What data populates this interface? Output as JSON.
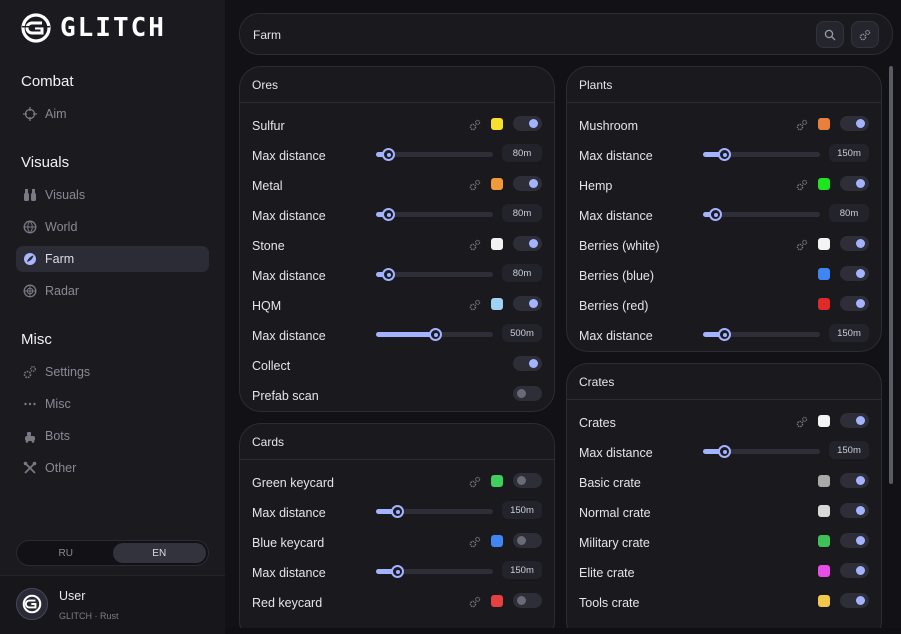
{
  "brand": {
    "name": "GLITCH"
  },
  "sidebar": {
    "sections": [
      {
        "title": "Combat",
        "items": [
          {
            "label": "Aim",
            "icon": "crosshair-icon"
          }
        ]
      },
      {
        "title": "Visuals",
        "items": [
          {
            "label": "Visuals",
            "icon": "binoculars-icon"
          },
          {
            "label": "World",
            "icon": "globe-icon"
          },
          {
            "label": "Farm",
            "icon": "leaf-icon",
            "active": true
          },
          {
            "label": "Radar",
            "icon": "radar-icon"
          }
        ]
      },
      {
        "title": "Misc",
        "items": [
          {
            "label": "Settings",
            "icon": "gears-icon"
          },
          {
            "label": "Misc",
            "icon": "dots-icon"
          },
          {
            "label": "Bots",
            "icon": "bots-icon"
          },
          {
            "label": "Other",
            "icon": "tools-icon"
          }
        ]
      }
    ],
    "language": {
      "options": [
        "RU",
        "EN"
      ],
      "selected": "EN"
    },
    "user": {
      "name": "User",
      "subtitle": "GLITCH · Rust"
    }
  },
  "topbar": {
    "title": "Farm"
  },
  "colors": {
    "accent": "#a4b3ff",
    "sulfur": "#f7df2e",
    "metal": "#f09a3e",
    "stone": "#f2f2f2",
    "hqm": "#9fd3f5",
    "green_keycard": "#3fcf5c",
    "blue_keycard": "#3f86f2",
    "red_keycard": "#e84040",
    "mushroom": "#e9803c",
    "hemp": "#1fe51f",
    "berries_white": "#f4f4f4",
    "berries_blue": "#3f86f2",
    "berries_red": "#e02a2a",
    "crates": "#f4f4f4",
    "basic_crate": "#a9a9a9",
    "normal_crate": "#d8d8d8",
    "military_crate": "#3fc15a",
    "elite_crate": "#e84de8",
    "tools_crate": "#f4c84a"
  },
  "ores": {
    "title": "Ores",
    "sulfur": {
      "label": "Sulfur",
      "enabled": true
    },
    "sulfur_dist": {
      "label": "Max distance",
      "value": "80m",
      "level": 0.1
    },
    "metal": {
      "label": "Metal",
      "enabled": true
    },
    "metal_dist": {
      "label": "Max distance",
      "value": "80m",
      "level": 0.1
    },
    "stone": {
      "label": "Stone",
      "enabled": true
    },
    "stone_dist": {
      "label": "Max distance",
      "value": "80m",
      "level": 0.1
    },
    "hqm": {
      "label": "HQM",
      "enabled": true
    },
    "hqm_dist": {
      "label": "Max distance",
      "value": "500m",
      "level": 0.5
    },
    "collect": {
      "label": "Collect",
      "enabled": true
    },
    "prefab": {
      "label": "Prefab scan",
      "enabled": false
    }
  },
  "cards": {
    "title": "Cards",
    "green": {
      "label": "Green keycard",
      "enabled": false
    },
    "green_dist": {
      "label": "Max distance",
      "value": "150m",
      "level": 0.18
    },
    "blue": {
      "label": "Blue keycard",
      "enabled": false
    },
    "blue_dist": {
      "label": "Max distance",
      "value": "150m",
      "level": 0.18
    },
    "red": {
      "label": "Red keycard",
      "enabled": false
    }
  },
  "plants": {
    "title": "Plants",
    "mushroom": {
      "label": "Mushroom",
      "enabled": true
    },
    "mushroom_dist": {
      "label": "Max distance",
      "value": "150m",
      "level": 0.18
    },
    "hemp": {
      "label": "Hemp",
      "enabled": true
    },
    "hemp_dist": {
      "label": "Max distance",
      "value": "80m",
      "level": 0.1
    },
    "berries_white": {
      "label": "Berries (white)",
      "enabled": true
    },
    "berries_blue": {
      "label": "Berries (blue)",
      "enabled": true
    },
    "berries_red": {
      "label": "Berries (red)",
      "enabled": true
    },
    "berries_dist": {
      "label": "Max distance",
      "value": "150m",
      "level": 0.18
    }
  },
  "crates": {
    "title": "Crates",
    "crates": {
      "label": "Crates",
      "enabled": true
    },
    "crates_dist": {
      "label": "Max distance",
      "value": "150m",
      "level": 0.18
    },
    "basic": {
      "label": "Basic crate",
      "enabled": true
    },
    "normal": {
      "label": "Normal crate",
      "enabled": true
    },
    "military": {
      "label": "Military crate",
      "enabled": true
    },
    "elite": {
      "label": "Elite crate",
      "enabled": true
    },
    "tools": {
      "label": "Tools crate",
      "enabled": true
    }
  }
}
